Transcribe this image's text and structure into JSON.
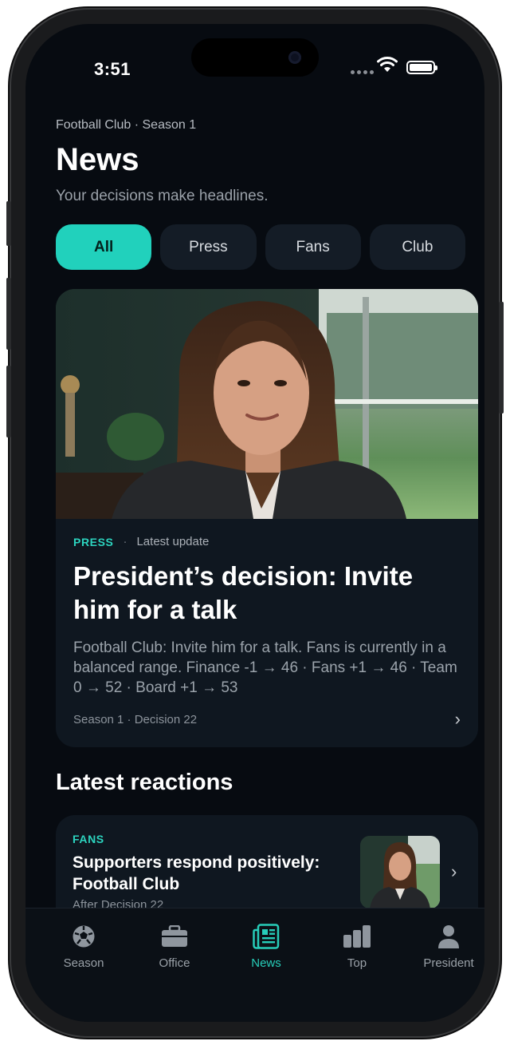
{
  "status_bar": {
    "time": "3:51"
  },
  "header": {
    "eyebrow": "Football Club · Season 1",
    "title": "News",
    "subtitle": "Your decisions make headlines."
  },
  "filters": [
    {
      "label": "All",
      "active": true
    },
    {
      "label": "Press",
      "active": false
    },
    {
      "label": "Fans",
      "active": false
    },
    {
      "label": "Club",
      "active": false
    }
  ],
  "featured": {
    "tag": "PRESS",
    "separator": "·",
    "meta": "Latest update",
    "headline": "President’s decision: Invite him for a talk",
    "description": "Football Club: Invite him for a talk. Fans is currently in a balanced range. Finance -1 → 46 · Fans +1 → 46 · Team 0 → 52 · Board +1 → 53",
    "footer": "Season 1 · Decision 22",
    "chevron": "›"
  },
  "reactions": {
    "heading": "Latest reactions",
    "items": [
      {
        "tag": "FANS",
        "title": "Supporters respond positively: Football Club",
        "subtitle": "After Decision 22",
        "chevron": "›"
      }
    ]
  },
  "tabbar": {
    "items": [
      {
        "label": "Season",
        "icon": "soccer-ball-icon",
        "active": false
      },
      {
        "label": "Office",
        "icon": "briefcase-icon",
        "active": false
      },
      {
        "label": "News",
        "icon": "newspaper-icon",
        "active": true
      },
      {
        "label": "Top",
        "icon": "bar-chart-icon",
        "active": false
      },
      {
        "label": "President",
        "icon": "person-icon",
        "active": false
      }
    ]
  },
  "colors": {
    "accent": "#21d1bc",
    "background": "#070b11",
    "card": "#0f1720"
  }
}
